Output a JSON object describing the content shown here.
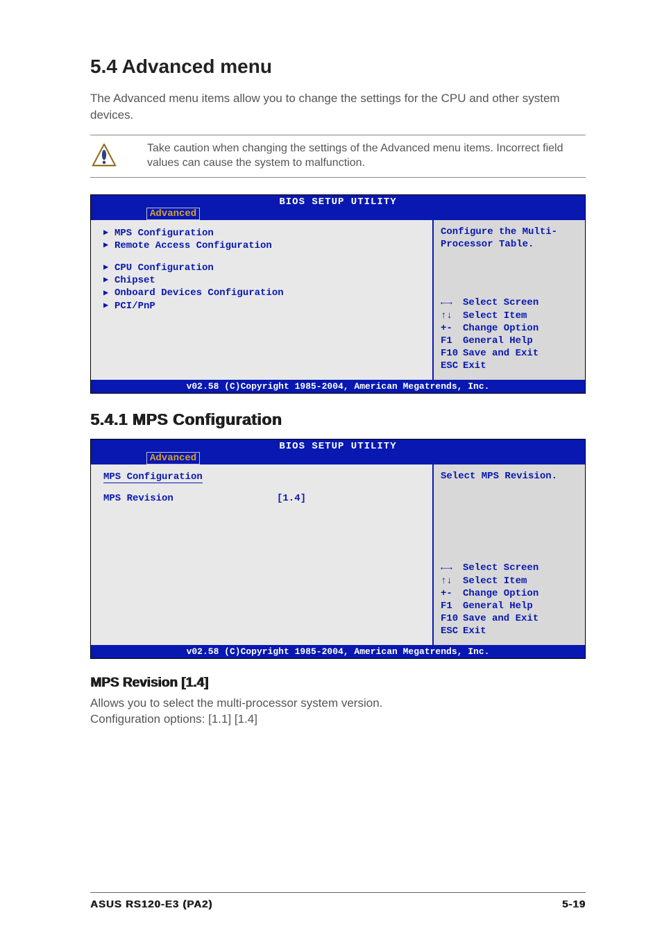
{
  "heading": "5.4    Advanced menu",
  "intro": "The Advanced menu items allow you to change the settings for the CPU and other system devices.",
  "caution": "Take caution when changing the settings of the Advanced menu items. Incorrect field values can cause the system to malfunction.",
  "bios1": {
    "title": "BIOS SETUP UTILITY",
    "tab": "Advanced",
    "menu_group1": [
      "MPS Configuration",
      "Remote Access Configuration"
    ],
    "menu_group2": [
      "CPU Configuration",
      "Chipset",
      "Onboard Devices Configuration",
      "PCI/PnP"
    ],
    "help_top_line1": "Configure the Multi-",
    "help_top_line2": "Processor Table.",
    "nav": [
      {
        "key": "←→",
        "label": "Select Screen"
      },
      {
        "key": "↑↓",
        "label": "Select Item"
      },
      {
        "key": "+-",
        "label": "Change Option"
      },
      {
        "key": "F1",
        "label": "General Help"
      },
      {
        "key": "F10",
        "label": "Save and Exit"
      },
      {
        "key": "ESC",
        "label": "Exit"
      }
    ],
    "footer": "v02.58 (C)Copyright 1985-2004, American Megatrends, Inc."
  },
  "subheading1": "5.4.1   MPS Configuration",
  "bios2": {
    "title": "BIOS SETUP UTILITY",
    "tab": "Advanced",
    "cfg_heading": "MPS Configuration",
    "cfg_label": "MPS Revision",
    "cfg_value": "[1.4]",
    "help_top": "Select MPS Revision.",
    "nav": [
      {
        "key": "←→",
        "label": "Select Screen"
      },
      {
        "key": "↑↓",
        "label": "Select Item"
      },
      {
        "key": "+-",
        "label": "Change Option"
      },
      {
        "key": "F1",
        "label": "General Help"
      },
      {
        "key": "F10",
        "label": "Save and Exit"
      },
      {
        "key": "ESC",
        "label": "Exit"
      }
    ],
    "footer": "v02.58 (C)Copyright 1985-2004, American Megatrends, Inc."
  },
  "item_heading": "MPS Revision [1.4]",
  "item_desc1": "Allows you to select the multi-processor system version.",
  "item_desc2": "Configuration options: [1.1] [1.4]",
  "footer_left": "ASUS RS120-E3 (PA2)",
  "footer_right": "5-19"
}
